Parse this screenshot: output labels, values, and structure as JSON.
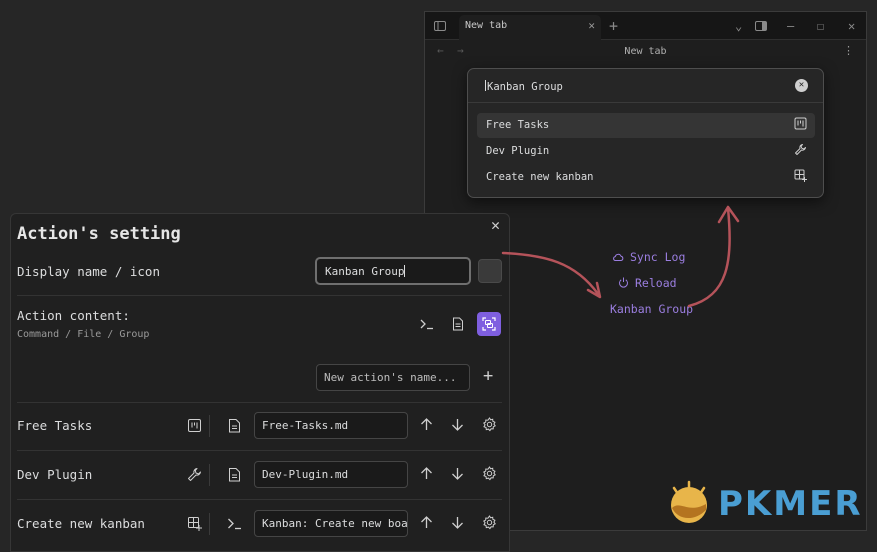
{
  "window": {
    "tab_title": "New tab",
    "view_title": "New tab",
    "center_links": [
      {
        "label": "Sync Log",
        "icon": "cloud-icon"
      },
      {
        "label": "Reload",
        "icon": "power-icon"
      },
      {
        "label": "Kanban Group",
        "icon": ""
      }
    ]
  },
  "palette": {
    "query": "Kanban Group",
    "suggestions": [
      {
        "label": "Free Tasks",
        "icon": "kanban-icon",
        "selected": true
      },
      {
        "label": "Dev Plugin",
        "icon": "wrench-icon",
        "selected": false
      },
      {
        "label": "Create new kanban",
        "icon": "layout-add-icon",
        "selected": false
      }
    ]
  },
  "modal": {
    "title": "Action's setting",
    "display_name_label": "Display name / icon",
    "display_name_value": "Kanban Group",
    "action_content_label": "Action content:",
    "action_content_desc": "Command / File / Group",
    "new_action_placeholder": "New action's name...",
    "actions": [
      {
        "name": "Free Tasks",
        "icon": "kanban-icon",
        "type_icon": "file-icon",
        "value": "Free-Tasks.md"
      },
      {
        "name": "Dev Plugin",
        "icon": "wrench-icon",
        "type_icon": "file-icon",
        "value": "Dev-Plugin.md"
      },
      {
        "name": "Create new kanban",
        "icon": "layout-add-icon",
        "type_icon": "terminal-icon",
        "value": "Kanban: Create new boa"
      }
    ]
  },
  "colors": {
    "accent": "#7f5fe0",
    "link": "#9b7ee0",
    "arrow": "#b5535a",
    "watermark": "#4a9ed3"
  },
  "watermark": {
    "text": "PKMER"
  }
}
